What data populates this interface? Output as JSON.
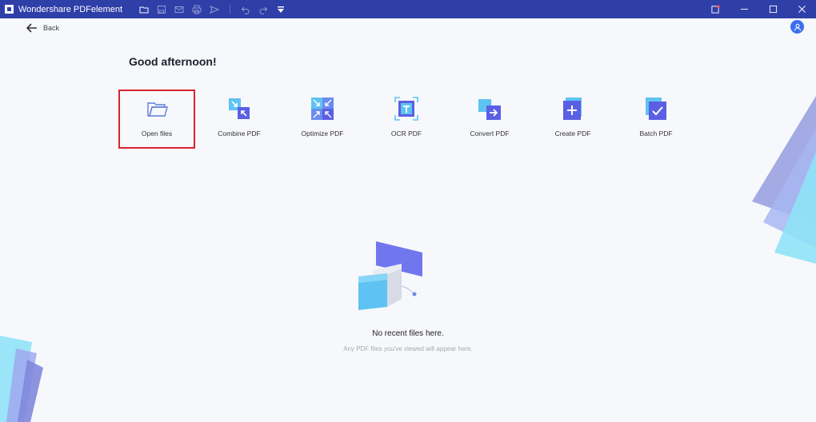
{
  "window": {
    "title": "Wondershare PDFelement"
  },
  "nav": {
    "back_label": "Back"
  },
  "greeting": "Good afternoon!",
  "actions": [
    {
      "label": "Open files",
      "icon": "folder-open-icon",
      "selected": true
    },
    {
      "label": "Combine PDF",
      "icon": "combine-pdf-icon"
    },
    {
      "label": "Optimize PDF",
      "icon": "optimize-pdf-icon"
    },
    {
      "label": "OCR PDF",
      "icon": "ocr-pdf-icon"
    },
    {
      "label": "Convert PDF",
      "icon": "convert-pdf-icon"
    },
    {
      "label": "Create PDF",
      "icon": "create-pdf-icon"
    },
    {
      "label": "Batch PDF",
      "icon": "batch-pdf-icon"
    }
  ],
  "empty_state": {
    "title": "No recent files here.",
    "subtitle": "Any PDF files you've viewed will appear here."
  },
  "colors": {
    "titlebar": "#2f3fa8",
    "accent": "#3b6ff0",
    "highlight_box": "#d9232d"
  }
}
